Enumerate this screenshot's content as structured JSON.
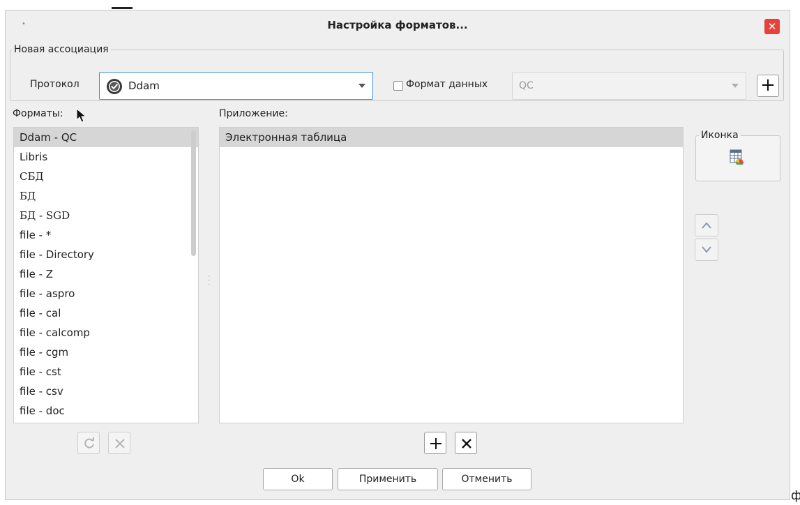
{
  "window": {
    "title": "Настройка форматов...",
    "close": "✕",
    "menu_dot": "•"
  },
  "association": {
    "legend": "Новая ассоциация",
    "protocol_label": "Протокол",
    "protocol_value": "Ddam",
    "data_format_checked": false,
    "data_format_label": "Формат данных",
    "data_format_value": "QC",
    "add_label": "+"
  },
  "formats": {
    "label": "Форматы:",
    "items": [
      "Ddam - QC",
      "Libris",
      "СБД",
      "БД",
      "БД  - SGD",
      "file - *",
      "file - Directory",
      "file - Z",
      "file - aspro",
      "file - cal",
      "file - calcomp",
      "file - cgm",
      "file - cst",
      "file - csv",
      "file - doc"
    ],
    "selected_index": 0
  },
  "application": {
    "label": "Приложение:",
    "items": [
      "Электронная таблица"
    ]
  },
  "icon_panel": {
    "legend": "Иконка"
  },
  "buttons": {
    "ok": "Ok",
    "apply": "Применить",
    "cancel": "Отменить"
  },
  "stray_text": "ф",
  "colors": {
    "accent": "#3d8ee0",
    "close": "#e5433a",
    "selection": "#d6d6d6",
    "window_bg": "#efefef"
  }
}
